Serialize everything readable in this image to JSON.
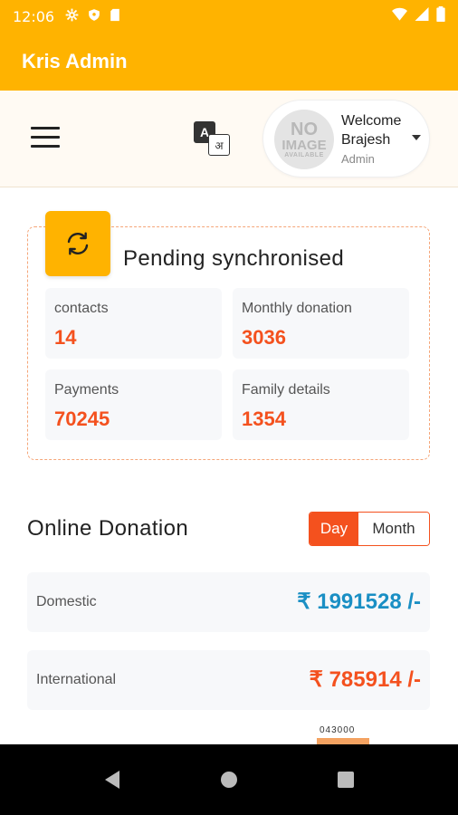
{
  "status_bar": {
    "time": "12:06"
  },
  "app": {
    "title": "Kris Admin"
  },
  "header": {
    "translate_a": "A",
    "translate_hi": "अ",
    "avatar_text": [
      "NO",
      "IMAGE",
      "AVAILABLE"
    ],
    "welcome": "Welcome",
    "user_name": "Brajesh",
    "role": "Admin"
  },
  "pending": {
    "title": "Pending synchronised",
    "stats": [
      {
        "label": "contacts",
        "value": "14"
      },
      {
        "label": "Monthly donation",
        "value": "3036"
      },
      {
        "label": "Payments",
        "value": "70245"
      },
      {
        "label": "Family details",
        "value": "1354"
      }
    ]
  },
  "online_donation": {
    "title": "Online Donation",
    "toggle": {
      "day": "Day",
      "month": "Month",
      "selected": "Day"
    },
    "items": [
      {
        "label": "Domestic",
        "amount": "₹ 1991528 /-",
        "color": "#1A8FC4"
      },
      {
        "label": "International",
        "amount": "₹ 785914 /-",
        "color": "#F4511E"
      }
    ]
  },
  "partial_footer_text": "043000",
  "colors": {
    "primary": "#FFB300",
    "accent": "#F4511E",
    "domestic": "#1A8FC4"
  },
  "icons": [
    "settings-icon",
    "shield-icon",
    "sd-card-icon",
    "wifi-icon",
    "signal-icon",
    "battery-icon",
    "menu-icon",
    "translate-icon",
    "sync-icon",
    "back-icon",
    "home-icon",
    "recents-icon"
  ]
}
